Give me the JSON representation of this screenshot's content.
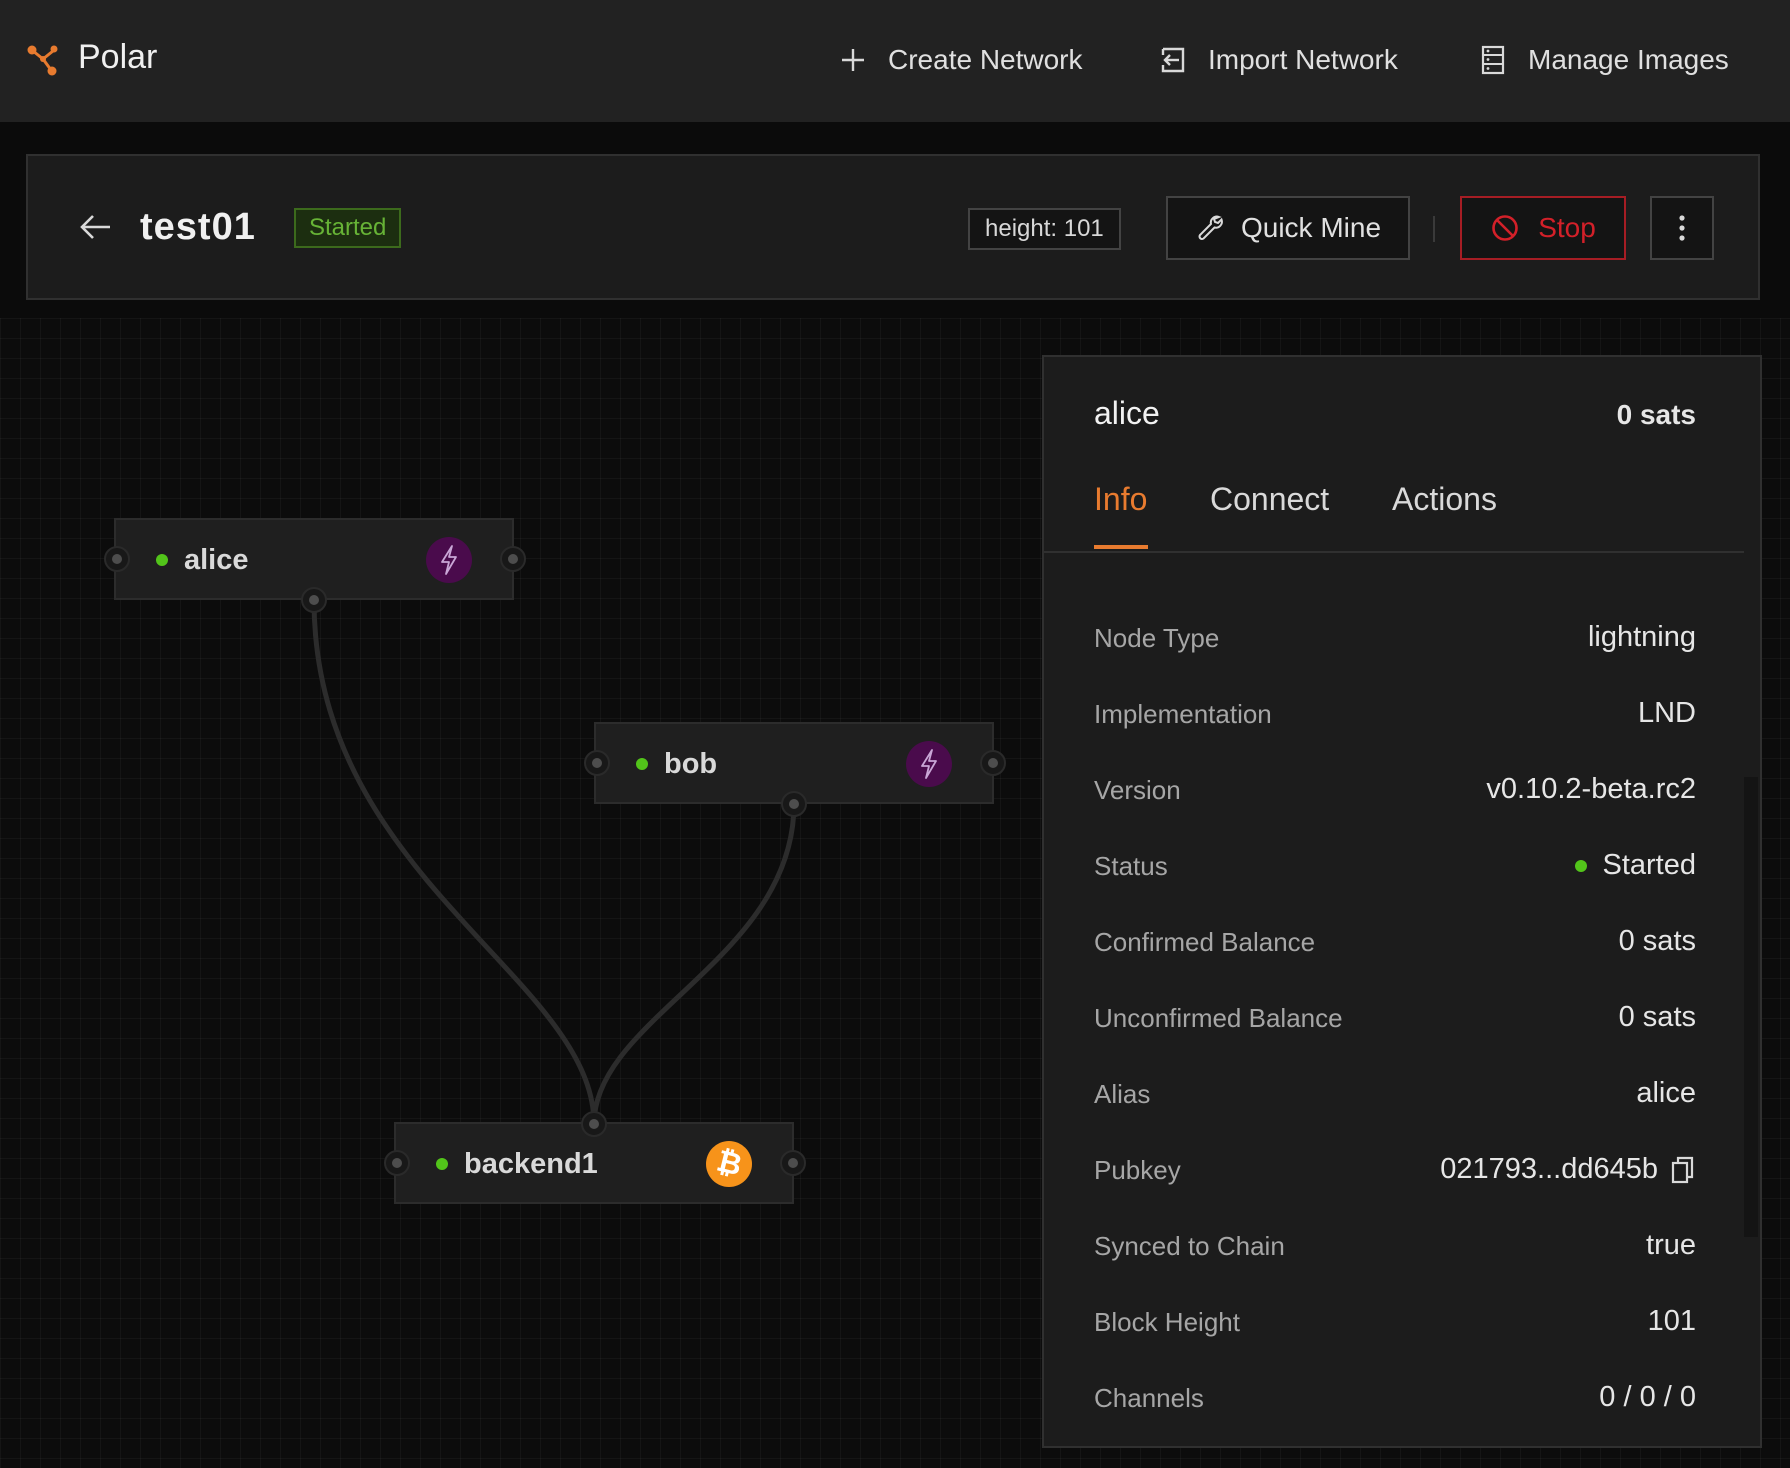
{
  "app": {
    "title": "Polar",
    "brand_color": "#e87b2f"
  },
  "nav": {
    "create_label": "Create Network",
    "import_label": "Import Network",
    "images_label": "Manage Images"
  },
  "network": {
    "name": "test01",
    "status": "Started",
    "height_label": "height: 101",
    "quick_mine_label": "Quick Mine",
    "stop_label": "Stop"
  },
  "nodes": [
    {
      "name": "alice",
      "type": "lightning",
      "status": "online",
      "icon": "lightning-icon"
    },
    {
      "name": "bob",
      "type": "lightning",
      "status": "online",
      "icon": "lightning-icon"
    },
    {
      "name": "backend1",
      "type": "bitcoin",
      "status": "online",
      "icon": "bitcoin-icon"
    }
  ],
  "details": {
    "title": "alice",
    "balance": "0 sats",
    "tabs": [
      "Info",
      "Connect",
      "Actions"
    ],
    "active_tab": "Info",
    "rows": [
      {
        "key": "Node Type",
        "value": "lightning"
      },
      {
        "key": "Implementation",
        "value": "LND"
      },
      {
        "key": "Version",
        "value": "v0.10.2-beta.rc2"
      },
      {
        "key": "Status",
        "value": "Started"
      },
      {
        "key": "Confirmed Balance",
        "value": "0 sats"
      },
      {
        "key": "Unconfirmed Balance",
        "value": "0 sats"
      },
      {
        "key": "Alias",
        "value": "alice"
      },
      {
        "key": "Pubkey",
        "value": "021793...dd645b"
      },
      {
        "key": "Synced to Chain",
        "value": "true"
      },
      {
        "key": "Block Height",
        "value": "101"
      },
      {
        "key": "Channels",
        "value": "0 / 0 / 0"
      }
    ]
  },
  "colors": {
    "header_bg": "#222222",
    "status_green": "#52c41a",
    "stop_red": "#d32029",
    "lightning_purple": "#4a0b4c",
    "bitcoin_orange": "#f7931a"
  }
}
